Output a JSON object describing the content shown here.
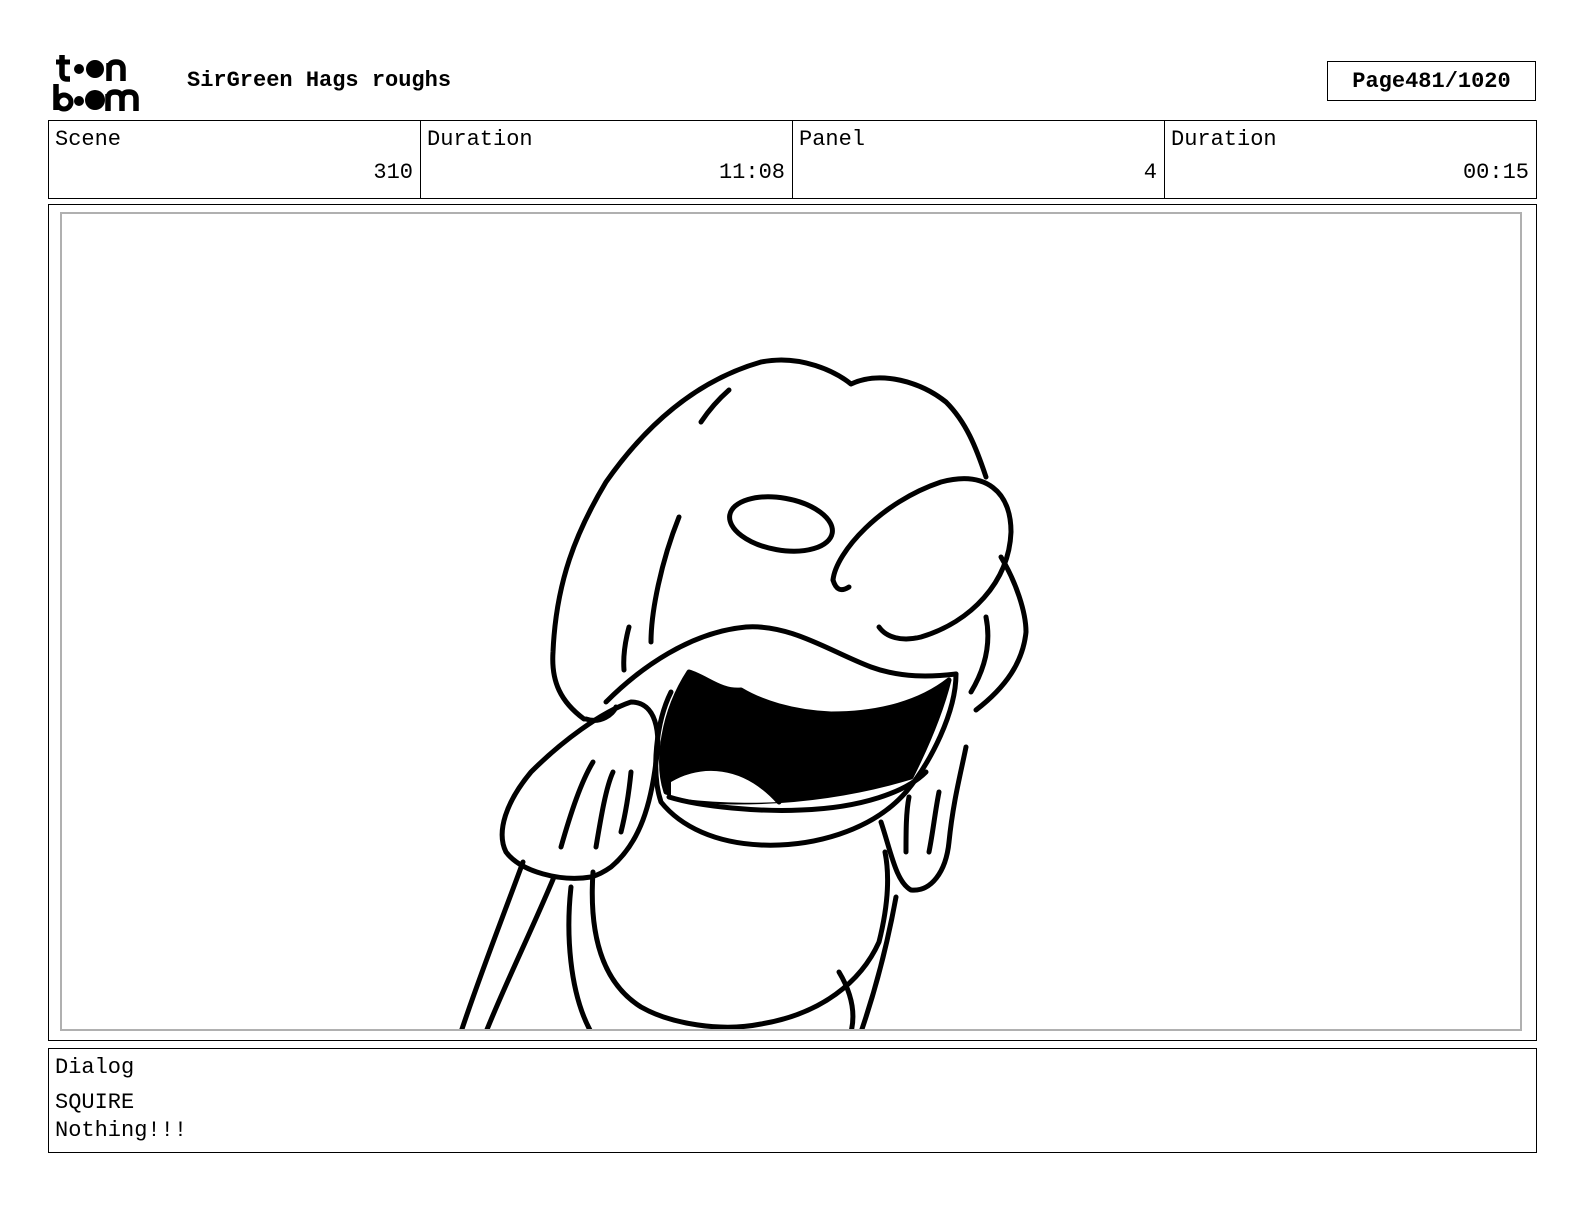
{
  "header": {
    "logo_text": "toon boom",
    "project_title": "SirGreen Hags roughs",
    "page_label": "Page",
    "page_value": "481/1020"
  },
  "info": {
    "scene_label": "Scene",
    "scene_value": "310",
    "scene_duration_label": "Duration",
    "scene_duration_value": "11:08",
    "panel_label": "Panel",
    "panel_value": "4",
    "panel_duration_label": "Duration",
    "panel_duration_value": "00:15"
  },
  "dialog": {
    "label": "Dialog",
    "character": "SQUIRE",
    "line": "Nothing!!!"
  }
}
